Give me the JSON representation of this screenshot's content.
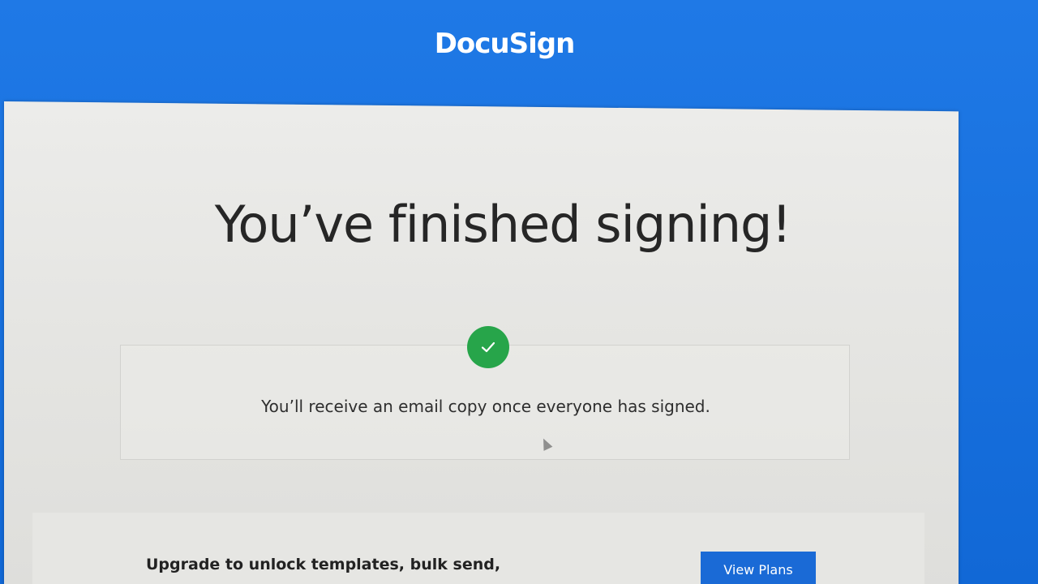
{
  "header": {
    "logo_text": "DocuSign"
  },
  "main": {
    "headline": "You’ve finished signing!",
    "status_icon": "check-icon",
    "status_color": "#27a54a",
    "message": "You’ll receive an email copy once everyone has signed."
  },
  "footer": {
    "upgrade_text": "Upgrade to unlock templates, bulk send,",
    "view_plans_label": "View Plans"
  },
  "colors": {
    "brand_blue": "#1670e0",
    "button_blue": "#1a6ad6"
  }
}
